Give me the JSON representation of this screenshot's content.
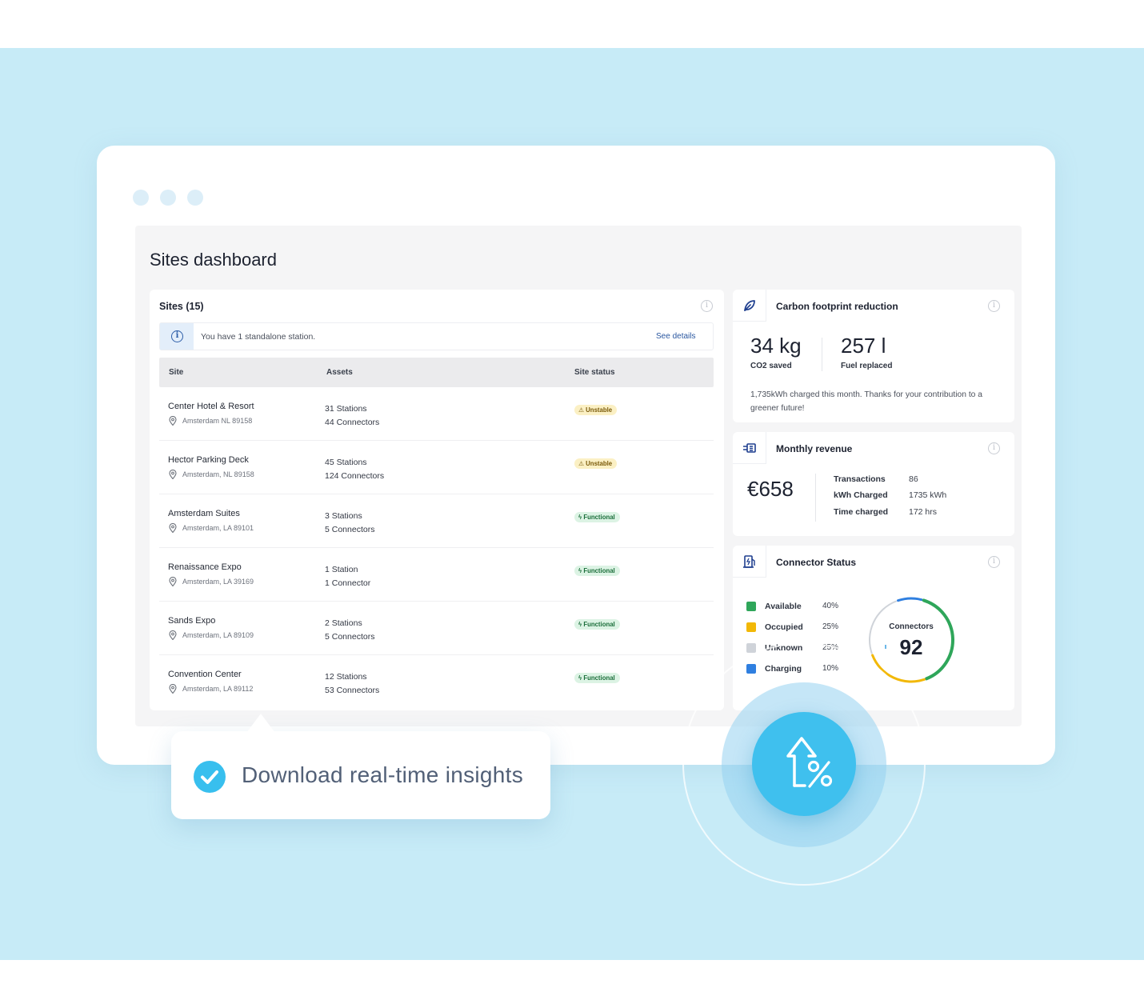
{
  "app": {
    "page_title": "Sites dashboard"
  },
  "sites": {
    "title": "Sites (15)",
    "banner_text": "You have 1 standalone station.",
    "banner_link": "See details",
    "columns": [
      "Site",
      "Assets",
      "Site status"
    ],
    "rows": [
      {
        "name": "Center Hotel & Resort",
        "location": "Amsterdam NL 89158",
        "stations": "31 Stations",
        "connectors": "44 Connectors",
        "status": "Unstable"
      },
      {
        "name": "Hector Parking Deck",
        "location": "Amsterdam, NL 89158",
        "stations": "45 Stations",
        "connectors": "124 Connectors",
        "status": "Unstable"
      },
      {
        "name": "Amsterdam Suites",
        "location": "Amsterdam, LA 89101",
        "stations": "3 Stations",
        "connectors": "5 Connectors",
        "status": "Functional"
      },
      {
        "name": "Renaissance Expo",
        "location": "Amsterdam, LA 39169",
        "stations": "1 Station",
        "connectors": "1 Connector",
        "status": "Functional"
      },
      {
        "name": "Sands Expo",
        "location": "Amsterdam, LA 89109",
        "stations": "2 Stations",
        "connectors": "5 Connectors",
        "status": "Functional"
      },
      {
        "name": "Convention Center",
        "location": "Amsterdam, LA 89112",
        "stations": "12 Stations",
        "connectors": "53 Connectors",
        "status": "Functional"
      }
    ]
  },
  "carbon": {
    "title": "Carbon footprint reduction",
    "co2_value": "34 kg",
    "co2_label": "CO2 saved",
    "fuel_value": "257 l",
    "fuel_label": "Fuel replaced",
    "description": "1,735kWh charged this month. Thanks for your contribution to a greener future!"
  },
  "revenue": {
    "title": "Monthly revenue",
    "amount": "€658",
    "stats": [
      {
        "label": "Transactions",
        "value": "86"
      },
      {
        "label": "kWh Charged",
        "value": "1735 kWh"
      },
      {
        "label": "Time charged",
        "value": "172 hrs"
      }
    ]
  },
  "connectors": {
    "title": "Connector Status",
    "center_label": "Connectors",
    "total": "92",
    "legend": [
      {
        "label": "Available",
        "value": "40%",
        "pct": 40,
        "color": "#2fa65a"
      },
      {
        "label": "Occupied",
        "value": "25%",
        "pct": 25,
        "color": "#f2b807"
      },
      {
        "label": "Unknown",
        "value": "25%",
        "pct": 25,
        "color": "#cfd3d9"
      },
      {
        "label": "Charging",
        "value": "10%",
        "pct": 10,
        "color": "#2f7fe0"
      }
    ]
  },
  "callout": {
    "text": "Download real-time insights"
  },
  "colors": {
    "background": "#c7ebf7",
    "accent": "#3fc0ee",
    "unstable": "#fbf0c4",
    "functional": "#dcf3e4"
  }
}
